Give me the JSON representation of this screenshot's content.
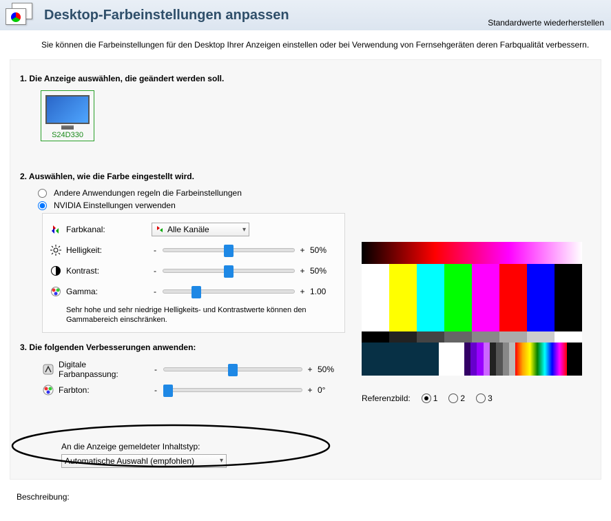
{
  "header": {
    "title": "Desktop-Farbeinstellungen anpassen",
    "restore_defaults": "Standardwerte wiederherstellen"
  },
  "intro": "Sie können die Farbeinstellungen für den Desktop Ihrer Anzeigen einstellen oder bei Verwendung von Fernsehgeräten deren Farbqualität verbessern.",
  "step1": {
    "title": "1. Die Anzeige auswählen, die geändert werden soll.",
    "display_name": "S24D330"
  },
  "step2": {
    "title": "2. Auswählen, wie die Farbe eingestellt wird.",
    "radio_other": "Andere Anwendungen regeln die Farbeinstellungen",
    "radio_nvidia": "NVIDIA Einstellungen verwenden",
    "channel_label": "Farbkanal:",
    "channel_value": "Alle Kanäle",
    "brightness_label": "Helligkeit:",
    "brightness_value": "50%",
    "contrast_label": "Kontrast:",
    "contrast_value": "50%",
    "gamma_label": "Gamma:",
    "gamma_value": "1.00",
    "note": "Sehr hohe und sehr niedrige Helligkeits- und Kontrastwerte können den Gammabereich einschränken."
  },
  "step3": {
    "title": "3. Die folgenden Verbesserungen anwenden:",
    "vibrance_label": "Digitale Farbanpassung:",
    "vibrance_value": "50%",
    "hue_label": "Farbton:",
    "hue_value": "0°"
  },
  "reference": {
    "label": "Referenzbild:",
    "opt1": "1",
    "opt2": "2",
    "opt3": "3"
  },
  "content_type": {
    "label": "An die Anzeige gemeldeter Inhaltstyp:",
    "value": "Automatische Auswahl (empfohlen)"
  },
  "description_label": "Beschreibung:",
  "minus": "-",
  "plus": "+"
}
